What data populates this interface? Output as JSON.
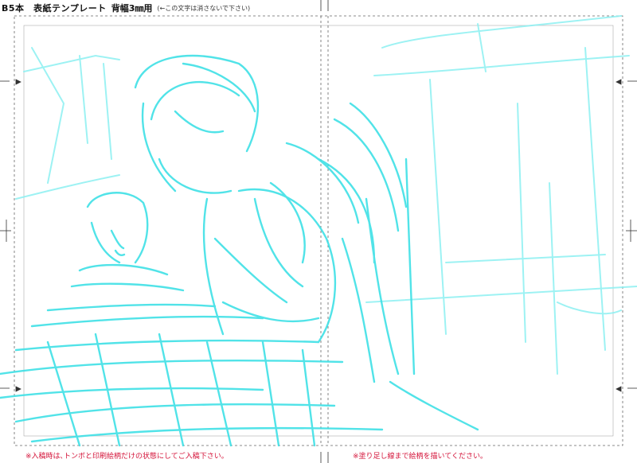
{
  "header": {
    "title": "B5本　表紙テンプレート",
    "spine": "背幅3㎜用",
    "note": "(←この文字は消さないで下さい)"
  },
  "footer": {
    "left_note": "※入稿時は､トンボと印刷絵柄だけの状態にしてご入稿下さい｡",
    "right_note": "※塗り足し線まで絵柄を描いてください｡"
  },
  "colors": {
    "sketch": "#3fe0e6",
    "sketch_light": "#8cf0f2",
    "guide": "#555555",
    "warning": "#d4143a"
  }
}
